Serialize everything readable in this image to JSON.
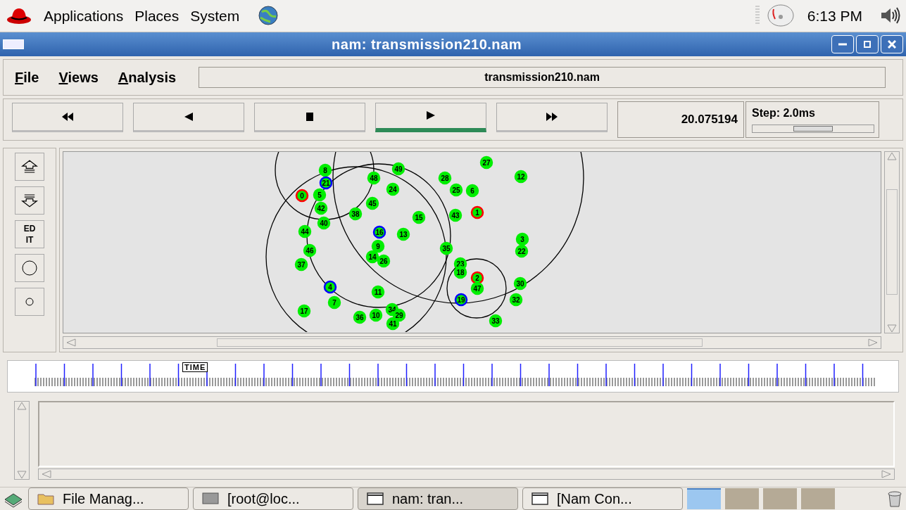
{
  "top_panel": {
    "menus": [
      "Applications",
      "Places",
      "System"
    ],
    "clock": "6:13 PM"
  },
  "window": {
    "title": "nam: transmission210.nam"
  },
  "menu": [
    "File",
    "Views",
    "Analysis"
  ],
  "file_label": "transmission210.nam",
  "playback": {
    "buttons": [
      {
        "kind": "rewind",
        "selected": false
      },
      {
        "kind": "back",
        "selected": false
      },
      {
        "kind": "stop",
        "selected": false
      },
      {
        "kind": "play",
        "selected": true
      },
      {
        "kind": "forward",
        "selected": false
      }
    ],
    "time": "20.075194",
    "step": "Step: 2.0ms",
    "step_slider": {
      "level": 0.5
    }
  },
  "tools": [
    {
      "kind": "zoom-in"
    },
    {
      "kind": "zoom-out"
    },
    {
      "kind": "edit",
      "label": "ED IT"
    },
    {
      "kind": "circle-large"
    },
    {
      "kind": "circle-small"
    }
  ],
  "nodes": [
    {
      "label": "8",
      "color": "#00ee00"
    },
    {
      "label": "21",
      "color": "#0000ff"
    },
    {
      "label": "0",
      "color": "#ff0000"
    },
    {
      "label": "5",
      "color": "#00ee00"
    },
    {
      "label": "42",
      "color": "#00ee00"
    },
    {
      "label": "40",
      "color": "#00ee00"
    },
    {
      "label": "44",
      "color": "#00ee00"
    },
    {
      "label": "46",
      "color": "#00ee00"
    },
    {
      "label": "37",
      "color": "#00ee00"
    },
    {
      "label": "4",
      "color": "#0000ff"
    },
    {
      "label": "7",
      "color": "#00ee00"
    },
    {
      "label": "17",
      "color": "#00ee00"
    },
    {
      "label": "36",
      "color": "#00ee00"
    },
    {
      "label": "10",
      "color": "#00ee00"
    },
    {
      "label": "34",
      "color": "#00ee00"
    },
    {
      "label": "29",
      "color": "#00ee00"
    },
    {
      "label": "41",
      "color": "#00ee00"
    },
    {
      "label": "11",
      "color": "#00ee00"
    },
    {
      "label": "14",
      "color": "#00ee00"
    },
    {
      "label": "26",
      "color": "#00ee00"
    },
    {
      "label": "16",
      "color": "#0000ff"
    },
    {
      "label": "9",
      "color": "#00ee00"
    },
    {
      "label": "13",
      "color": "#00ee00"
    },
    {
      "label": "38",
      "color": "#00ee00"
    },
    {
      "label": "45",
      "color": "#00ee00"
    },
    {
      "label": "15",
      "color": "#00ee00"
    },
    {
      "label": "24",
      "color": "#00ee00"
    },
    {
      "label": "49",
      "color": "#00ee00"
    },
    {
      "label": "48",
      "color": "#00ee00"
    },
    {
      "label": "27",
      "color": "#00ee00"
    },
    {
      "label": "28",
      "color": "#00ee00"
    },
    {
      "label": "12",
      "color": "#00ee00"
    },
    {
      "label": "25",
      "color": "#00ee00"
    },
    {
      "label": "6",
      "color": "#00ee00"
    },
    {
      "label": "1",
      "color": "#ff0000"
    },
    {
      "label": "43",
      "color": "#00ee00"
    },
    {
      "label": "35",
      "color": "#00ee00"
    },
    {
      "label": "3",
      "color": "#00ee00"
    },
    {
      "label": "22",
      "color": "#00ee00"
    },
    {
      "label": "23",
      "color": "#00ee00"
    },
    {
      "label": "18",
      "color": "#00ee00"
    },
    {
      "label": "2",
      "color": "#ff0000"
    },
    {
      "label": "47",
      "color": "#00ee00"
    },
    {
      "label": "19",
      "color": "#0000ff"
    },
    {
      "label": "30",
      "color": "#00ee00"
    },
    {
      "label": "32",
      "color": "#00ee00"
    },
    {
      "label": "33",
      "color": "#00ee00"
    }
  ],
  "timeline": {
    "marker": "TIME"
  },
  "taskbar": [
    {
      "kind": "folder",
      "label": "File Manag...",
      "selected": false
    },
    {
      "kind": "terminal",
      "label": "[root@loc...",
      "selected": false
    },
    {
      "kind": "window",
      "label": "nam: tran...",
      "selected": true
    },
    {
      "kind": "window",
      "label": "[Nam Con...",
      "selected": false
    }
  ],
  "workspaces": [
    {
      "selected": true
    },
    {
      "selected": false
    },
    {
      "selected": false
    },
    {
      "selected": false
    }
  ]
}
